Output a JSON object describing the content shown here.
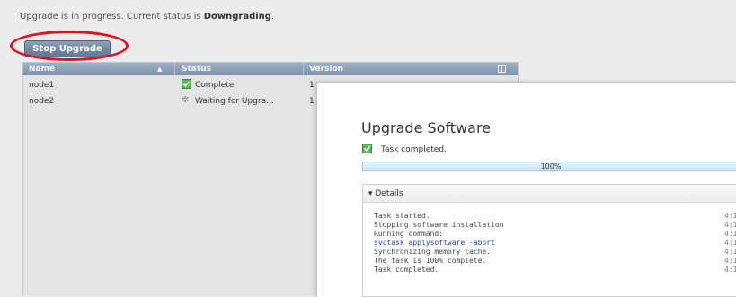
{
  "status_message": {
    "prefix": "Upgrade is in progress. Current status is ",
    "status": "Downgrading",
    "suffix": "."
  },
  "stop_button_label": "Stop Upgrade",
  "grid": {
    "columns": [
      "Name",
      "Status",
      "Version"
    ],
    "rows": [
      {
        "name": "node1",
        "status": "Complete",
        "status_icon": "check-icon",
        "version": "1"
      },
      {
        "name": "node2",
        "status": "Waiting for Upgra...",
        "status_icon": "spinner-icon",
        "version": "1"
      }
    ]
  },
  "dialog": {
    "title": "Upgrade Software",
    "task_status": "Task completed.",
    "progress_percent": 100,
    "progress_label": "100%",
    "details_label": "▾ Details",
    "log": [
      {
        "text": "Task started.",
        "time": "4:1"
      },
      {
        "text": "Stopping software installation",
        "time": "4:1"
      },
      {
        "text": "Running command:",
        "time": "4:1"
      },
      {
        "text": "svctask applysoftware -abort",
        "time": "4:1",
        "highlight": true
      },
      {
        "text": "Synchronizing memory cache.",
        "time": "4:1"
      },
      {
        "text": "The task is 100% complete.",
        "time": "4:1"
      },
      {
        "text": "Task completed.",
        "time": "4:1"
      }
    ]
  },
  "colors": {
    "annotation_circle": "#e0131e",
    "header_blue": "#7d93ad",
    "success_green": "#5cb85c",
    "command_blue": "#2a3f9e"
  }
}
